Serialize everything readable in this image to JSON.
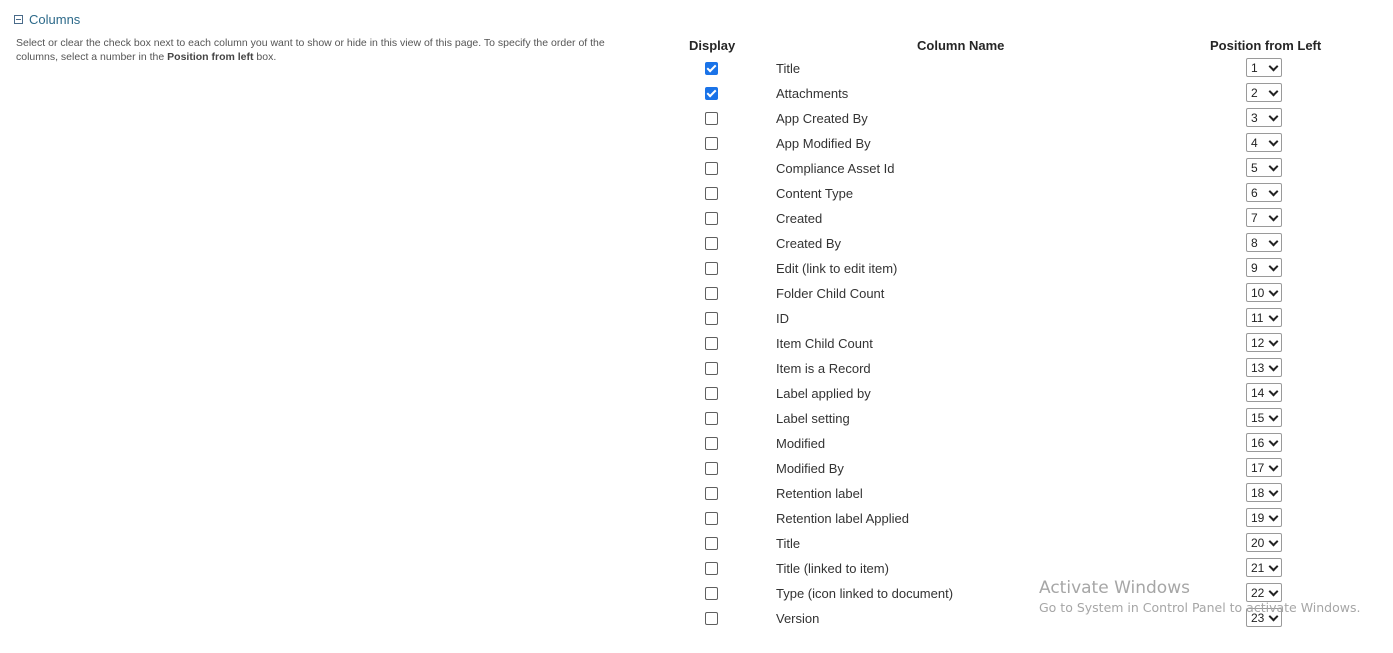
{
  "section": {
    "title": "Columns",
    "description_part1": "Select or clear the check box next to each column you want to show or hide in this view of this page. To specify the order of the columns, select a number in the ",
    "description_bold": "Position from left",
    "description_part2": " box."
  },
  "headers": {
    "display": "Display",
    "column_name": "Column Name",
    "position": "Position from Left"
  },
  "columns": [
    {
      "name": "Title",
      "checked": true,
      "position": "1"
    },
    {
      "name": "Attachments",
      "checked": true,
      "position": "2"
    },
    {
      "name": "App Created By",
      "checked": false,
      "position": "3"
    },
    {
      "name": "App Modified By",
      "checked": false,
      "position": "4"
    },
    {
      "name": "Compliance Asset Id",
      "checked": false,
      "position": "5"
    },
    {
      "name": "Content Type",
      "checked": false,
      "position": "6"
    },
    {
      "name": "Created",
      "checked": false,
      "position": "7"
    },
    {
      "name": "Created By",
      "checked": false,
      "position": "8"
    },
    {
      "name": "Edit (link to edit item)",
      "checked": false,
      "position": "9"
    },
    {
      "name": "Folder Child Count",
      "checked": false,
      "position": "10"
    },
    {
      "name": "ID",
      "checked": false,
      "position": "11"
    },
    {
      "name": "Item Child Count",
      "checked": false,
      "position": "12"
    },
    {
      "name": "Item is a Record",
      "checked": false,
      "position": "13"
    },
    {
      "name": "Label applied by",
      "checked": false,
      "position": "14"
    },
    {
      "name": "Label setting",
      "checked": false,
      "position": "15"
    },
    {
      "name": "Modified",
      "checked": false,
      "position": "16"
    },
    {
      "name": "Modified By",
      "checked": false,
      "position": "17"
    },
    {
      "name": "Retention label",
      "checked": false,
      "position": "18"
    },
    {
      "name": "Retention label Applied",
      "checked": false,
      "position": "19"
    },
    {
      "name": "Title",
      "checked": false,
      "position": "20"
    },
    {
      "name": "Title (linked to item)",
      "checked": false,
      "position": "21"
    },
    {
      "name": "Type (icon linked to document)",
      "checked": false,
      "position": "22"
    },
    {
      "name": "Version",
      "checked": false,
      "position": "23"
    }
  ],
  "watermark": {
    "title": "Activate Windows",
    "subtitle": "Go to System in Control Panel to activate Windows."
  },
  "colors": {
    "checked": "#1a73e8",
    "section_title": "#2d6a8a"
  }
}
